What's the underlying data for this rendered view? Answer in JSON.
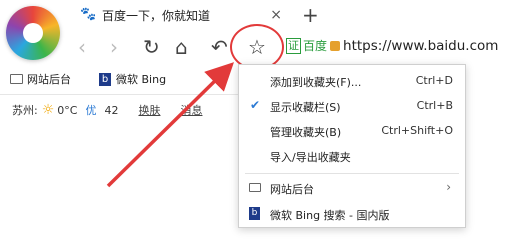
{
  "tab": {
    "icon": "baidu-paw-icon",
    "title": "百度一下，你就知道",
    "close": "×",
    "new_tab": "+"
  },
  "toolbar": {
    "back": "‹",
    "forward": "›",
    "refresh": "↻",
    "home": "⌂",
    "undo": "↶",
    "star": "☆",
    "cert_badge": "证",
    "site_name": "百度",
    "url": "https://www.baidu.com"
  },
  "bookmarks_bar": {
    "items": [
      {
        "icon": "folder-icon",
        "label": "网站后台"
      },
      {
        "icon": "bing-icon",
        "label": "微软 Bing"
      }
    ]
  },
  "weather": {
    "city": "苏州:",
    "icon": "sun-icon",
    "temperature": "0°C",
    "aqi_label": "优",
    "aqi_value": "42",
    "link1": "换肤",
    "link2": "消息"
  },
  "menu": {
    "items": [
      {
        "label": "添加到收藏夹(F)...",
        "shortcut": "Ctrl+D"
      },
      {
        "label": "显示收藏栏(S)",
        "shortcut": "Ctrl+B",
        "checked": true
      },
      {
        "label": "管理收藏夹(B)",
        "shortcut": "Ctrl+Shift+O"
      },
      {
        "label": "导入/导出收藏夹",
        "shortcut": ""
      }
    ],
    "folder": {
      "icon": "folder-icon",
      "label": "网站后台",
      "arrow": "›"
    },
    "bing": {
      "icon": "bing-icon",
      "label": "微软 Bing 搜索 - 国内版"
    }
  },
  "colors": {
    "annotation_red": "#e23a3a",
    "secure_green": "#2a9c3d",
    "check_blue": "#2d7bd4"
  }
}
